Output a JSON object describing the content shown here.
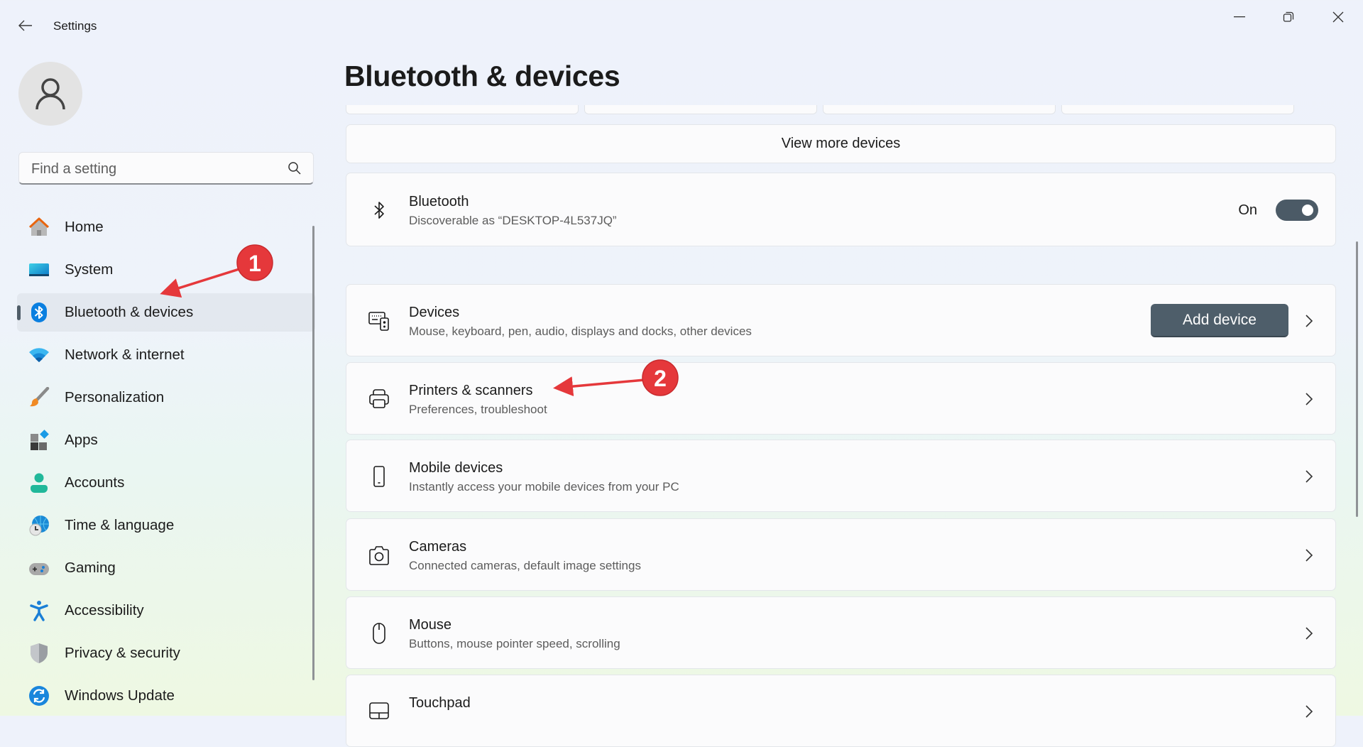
{
  "window": {
    "title": "Settings",
    "controls": {
      "minimize": "minimize-icon",
      "restore": "restore-icon",
      "close": "close-icon"
    }
  },
  "search": {
    "placeholder": "Find a setting",
    "value": ""
  },
  "sidebar": {
    "items": [
      {
        "label": "Home",
        "icon": "home-icon",
        "selected": false
      },
      {
        "label": "System",
        "icon": "system-icon",
        "selected": false
      },
      {
        "label": "Bluetooth & devices",
        "icon": "bluetooth-icon",
        "selected": true
      },
      {
        "label": "Network & internet",
        "icon": "wifi-icon",
        "selected": false
      },
      {
        "label": "Personalization",
        "icon": "paintbrush-icon",
        "selected": false
      },
      {
        "label": "Apps",
        "icon": "apps-icon",
        "selected": false
      },
      {
        "label": "Accounts",
        "icon": "account-icon",
        "selected": false
      },
      {
        "label": "Time & language",
        "icon": "globe-clock-icon",
        "selected": false
      },
      {
        "label": "Gaming",
        "icon": "gamepad-icon",
        "selected": false
      },
      {
        "label": "Accessibility",
        "icon": "accessibility-icon",
        "selected": false
      },
      {
        "label": "Privacy & security",
        "icon": "shield-icon",
        "selected": false
      },
      {
        "label": "Windows Update",
        "icon": "update-icon",
        "selected": false
      }
    ]
  },
  "main": {
    "page_title": "Bluetooth & devices",
    "view_more_label": "View more devices",
    "bluetooth": {
      "title": "Bluetooth",
      "subtitle": "Discoverable as “DESKTOP-4L537JQ”",
      "state_label": "On",
      "enabled": true
    },
    "cards": [
      {
        "title": "Devices",
        "subtitle": "Mouse, keyboard, pen, audio, displays and docks, other devices",
        "icon": "devices-icon",
        "button_label": "Add device"
      },
      {
        "title": "Printers & scanners",
        "subtitle": "Preferences, troubleshoot",
        "icon": "printer-icon"
      },
      {
        "title": "Mobile devices",
        "subtitle": "Instantly access your mobile devices from your PC",
        "icon": "phone-icon"
      },
      {
        "title": "Cameras",
        "subtitle": "Connected cameras, default image settings",
        "icon": "camera-icon"
      },
      {
        "title": "Mouse",
        "subtitle": "Buttons, mouse pointer speed, scrolling",
        "icon": "mouse-icon"
      },
      {
        "title": "Touchpad",
        "subtitle": "",
        "icon": "touchpad-icon"
      }
    ]
  },
  "annotations": [
    {
      "number": "1",
      "target": "Bluetooth & devices"
    },
    {
      "number": "2",
      "target": "Printers & scanners"
    }
  ],
  "colors": {
    "accent": "#4e5e6a",
    "annotation": "#e5383b",
    "bluetooth_blue": "#0a7fe0"
  }
}
